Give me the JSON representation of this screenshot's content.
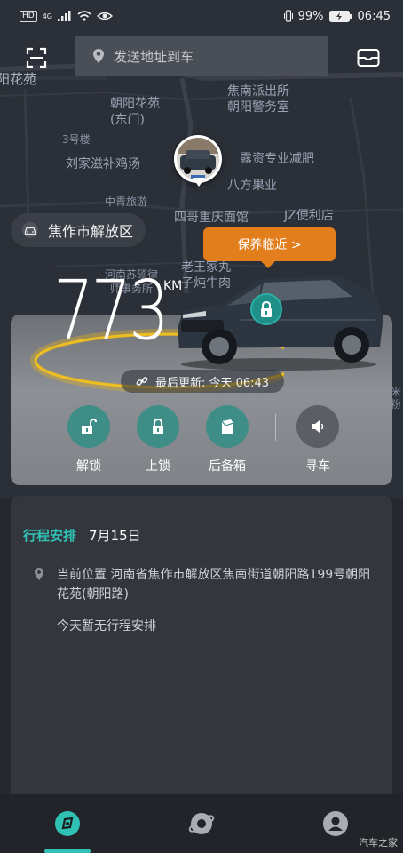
{
  "status_bar": {
    "hd_label": "HD",
    "net_label": "4G",
    "battery_percent": "99%",
    "time": "06:45"
  },
  "search": {
    "placeholder": "发送地址到车"
  },
  "map": {
    "labels": [
      "阳花苑",
      "朝阳花苑",
      "(东门)",
      "焦南派出所",
      "朝阳警务室",
      "3号楼",
      "刘家滋补鸡汤",
      "露资专业减肥",
      "八方果业",
      "中青旅游",
      "四哥重庆面馆",
      "JZ便利店",
      "河南苏硕律",
      "师事务所",
      "老王家丸",
      "子炖牛肉",
      "米",
      "粉"
    ]
  },
  "district": {
    "label": "焦作市解放区",
    "icon": "car-icon"
  },
  "maintenance": {
    "label": "保养临近 >"
  },
  "vehicle": {
    "range_value": "773",
    "range_unit": "KM",
    "last_update": "最后更新: 今天 06:43",
    "lock_status_icon": "lock-icon",
    "accent_color": "#2fc2b4",
    "glow_color": "#f2b40f"
  },
  "controls": [
    {
      "label": "解锁",
      "icon": "unlock-icon"
    },
    {
      "label": "上锁",
      "icon": "lock-icon"
    },
    {
      "label": "后备箱",
      "icon": "trunk-icon"
    },
    {
      "label": "寻车",
      "icon": "speaker-icon"
    }
  ],
  "schedule": {
    "title": "行程安排",
    "date": "7月15日",
    "location": "当前位置 河南省焦作市解放区焦南街道朝阳路199号朝阳花苑(朝阳路)",
    "empty_text": "今天暂无行程安排"
  },
  "bottom_nav": [
    {
      "name": "home",
      "icon": "car-home-icon"
    },
    {
      "name": "discover",
      "icon": "planet-icon"
    },
    {
      "name": "profile",
      "icon": "user-icon"
    }
  ],
  "watermark": "汽车之家"
}
